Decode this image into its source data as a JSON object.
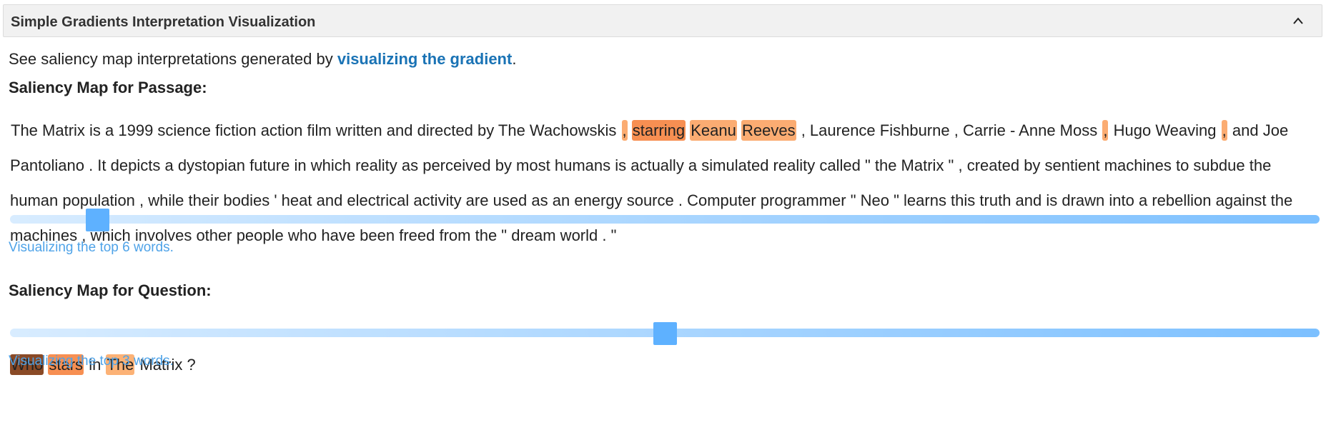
{
  "panel": {
    "title": "Simple Gradients Interpretation Visualization",
    "collapse_icon": "chevron-up-icon"
  },
  "intro": {
    "prefix": "See saliency map interpretations generated by ",
    "link": "visualizing the gradient",
    "suffix": "."
  },
  "passage": {
    "title": "Saliency Map for Passage:",
    "tokens": [
      {
        "t": "The Matrix is a 1999 science fiction action film written and directed by The Wachowskis"
      },
      {
        "t": ",",
        "hl": "hl-mid"
      },
      {
        "t": "starring",
        "hl": "hl-strong"
      },
      {
        "t": "Keanu",
        "hl": "hl-mid"
      },
      {
        "t": "Reeves",
        "hl": "hl-mid"
      },
      {
        "t": ", Laurence Fishburne , Carrie - Anne Moss"
      },
      {
        "t": ",",
        "hl": "hl-mid"
      },
      {
        "t": "Hugo Weaving"
      },
      {
        "t": ",",
        "hl": "hl-mid"
      },
      {
        "t": "and Joe Pantoliano . It depicts a dystopian future in which reality as perceived by most humans is actually a simulated reality called \" the Matrix \" , created by sentient machines to subdue the human population , while their bodies ' heat and electrical activity are used as an energy source . Computer programmer \" Neo \" learns this truth and is drawn into a rebellion against the machines , which involves other people who have been freed from the \" dream world . \""
      }
    ],
    "slider_value": 6,
    "slider_fraction": 0.059,
    "caption": "Visualizing the top 6 words."
  },
  "question": {
    "title": "Saliency Map for Question:",
    "tokens": [
      {
        "t": "Who",
        "hl": "hl-dark"
      },
      {
        "t": "stars",
        "hl": "hl-strong"
      },
      {
        "t": "in"
      },
      {
        "t": "The",
        "hl": "hl-light"
      },
      {
        "t": "Matrix ?"
      }
    ],
    "slider_value": 3,
    "slider_fraction": 0.5,
    "caption": "Visualizing the top 3 words."
  },
  "colors": {
    "link": "#1a73b5",
    "caption": "#4fa3e8",
    "slider_thumb": "#5eb1ff",
    "highlight_strong": "#f78f52",
    "highlight_mid": "#fbac72",
    "highlight_dark": "#8a4a26"
  }
}
